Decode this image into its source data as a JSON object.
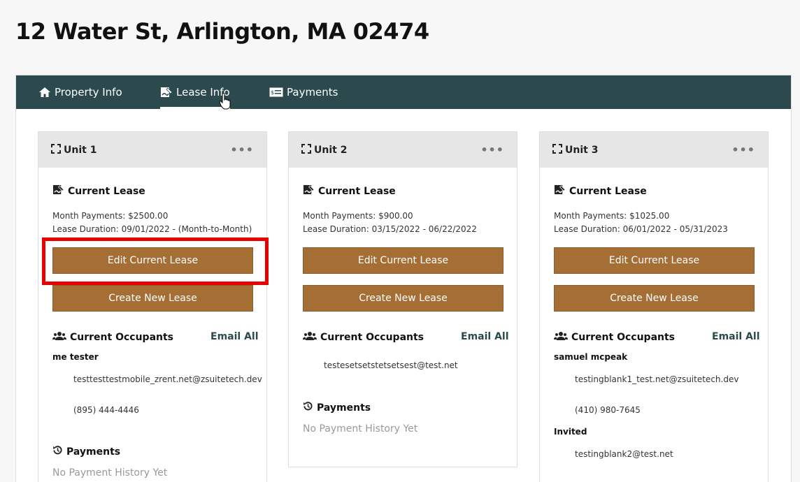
{
  "page": {
    "title": "12 Water St, Arlington, MA 02474"
  },
  "tabs": [
    {
      "label": "Property Info",
      "icon": "home-icon"
    },
    {
      "label": "Lease Info",
      "icon": "lease-sign-icon",
      "active": true
    },
    {
      "label": "Payments",
      "icon": "payment-card-icon"
    }
  ],
  "units": [
    {
      "name": "Unit 1",
      "current_lease_title": "Current Lease",
      "month_payments": "Month Payments: $2500.00",
      "lease_duration": "Lease Duration: 09/01/2022 - (Month-to-Month)",
      "edit_lease": "Edit Current Lease",
      "create_lease": "Create New Lease",
      "occupants_title": "Current Occupants",
      "email_all": "Email All",
      "occupant_name": "me tester",
      "occupant_email": "testtesttestmobile_zrent.net@zsuitetech.dev",
      "occupant_phone": "(895) 444-4446",
      "payments_title": "Payments",
      "payments_empty": "No Payment History Yet"
    },
    {
      "name": "Unit 2",
      "current_lease_title": "Current Lease",
      "month_payments": "Month Payments: $900.00",
      "lease_duration": "Lease Duration: 03/15/2022 - 06/22/2022",
      "edit_lease": "Edit Current Lease",
      "create_lease": "Create New Lease",
      "occupants_title": "Current Occupants",
      "email_all": "Email All",
      "occupant_email": "testesetsetstetsetsest@test.net",
      "payments_title": "Payments",
      "payments_empty": "No Payment History Yet"
    },
    {
      "name": "Unit 3",
      "current_lease_title": "Current Lease",
      "month_payments": "Month Payments: $1025.00",
      "lease_duration": "Lease Duration: 06/01/2022 - 05/31/2023",
      "edit_lease": "Edit Current Lease",
      "create_lease": "Create New Lease",
      "occupants_title": "Current Occupants",
      "email_all": "Email All",
      "occupant_name": "samuel mcpeak",
      "occupant_email": "testingblank1_test.net@zsuitetech.dev",
      "occupant_phone": "(410) 980-7645",
      "invited_title": "Invited",
      "invited_email": "testingblank2@test.net"
    }
  ],
  "colors": {
    "tabbar": "#2c4a4e",
    "button": "#a56e34",
    "highlight": "#e80000"
  }
}
